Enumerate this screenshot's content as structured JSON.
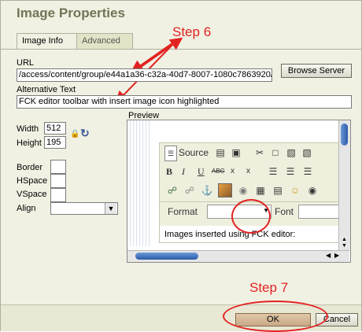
{
  "dialog": {
    "title": "Image Properties",
    "tabs": [
      "Image Info",
      "Advanced"
    ]
  },
  "annotations": {
    "step6": "Step 6",
    "step7": "Step 7",
    "accent_color": "#e22222"
  },
  "image_info": {
    "url_label": "URL",
    "url_value": "/access/content/group/e44a1a36-c32a-40d7-8007-1080c7863920/",
    "browse_label": "Browse Server",
    "alt_label": "Alternative Text",
    "alt_value": "FCK editor toolbar with insert image icon highlighted",
    "width_label": "Width",
    "width_value": "512",
    "height_label": "Height",
    "height_value": "195",
    "border_label": "Border",
    "hspace_label": "HSpace",
    "vspace_label": "VSpace",
    "align_label": "Align",
    "preview_label": "Preview"
  },
  "preview": {
    "source_label": "Source",
    "bold": "B",
    "italic": "I",
    "underline": "U",
    "strike": "ABC",
    "subscript": "x",
    "superscript": "x",
    "format_label": "Format",
    "font_label": "Font",
    "editor_text": "Images inserted using FCK editor:"
  },
  "footer": {
    "ok_label": "OK",
    "cancel_label": "Cancel"
  }
}
